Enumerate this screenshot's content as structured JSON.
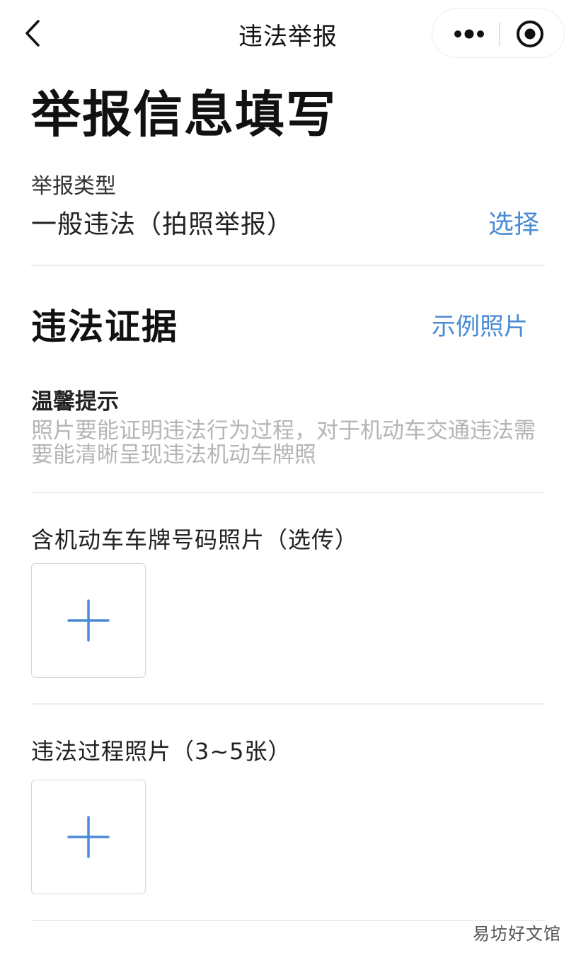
{
  "nav": {
    "title": "违法举报",
    "back_icon": "chevron-left-icon",
    "more_icon": "more-dots-icon",
    "close_icon": "target-close-icon"
  },
  "page_title": "举报信息填写",
  "report_type": {
    "label": "举报类型",
    "value": "一般违法（拍照举报）",
    "action": "选择"
  },
  "evidence": {
    "title": "违法证据",
    "example_link": "示例照片",
    "tip_title": "温馨提示",
    "tip_text": "照片要能证明违法行为过程，对于机动车交通违法需要能清晰呈现违法机动车牌照"
  },
  "uploads": [
    {
      "label": "含机动车车牌号码照片（选传）",
      "icon": "plus-icon"
    },
    {
      "label": "违法过程照片（3~5张）",
      "icon": "plus-icon"
    }
  ],
  "watermark": "易坊好文馆",
  "colors": {
    "accent": "#4a8bd6",
    "hint_text": "#b5b5b5",
    "divider": "#ececec"
  }
}
